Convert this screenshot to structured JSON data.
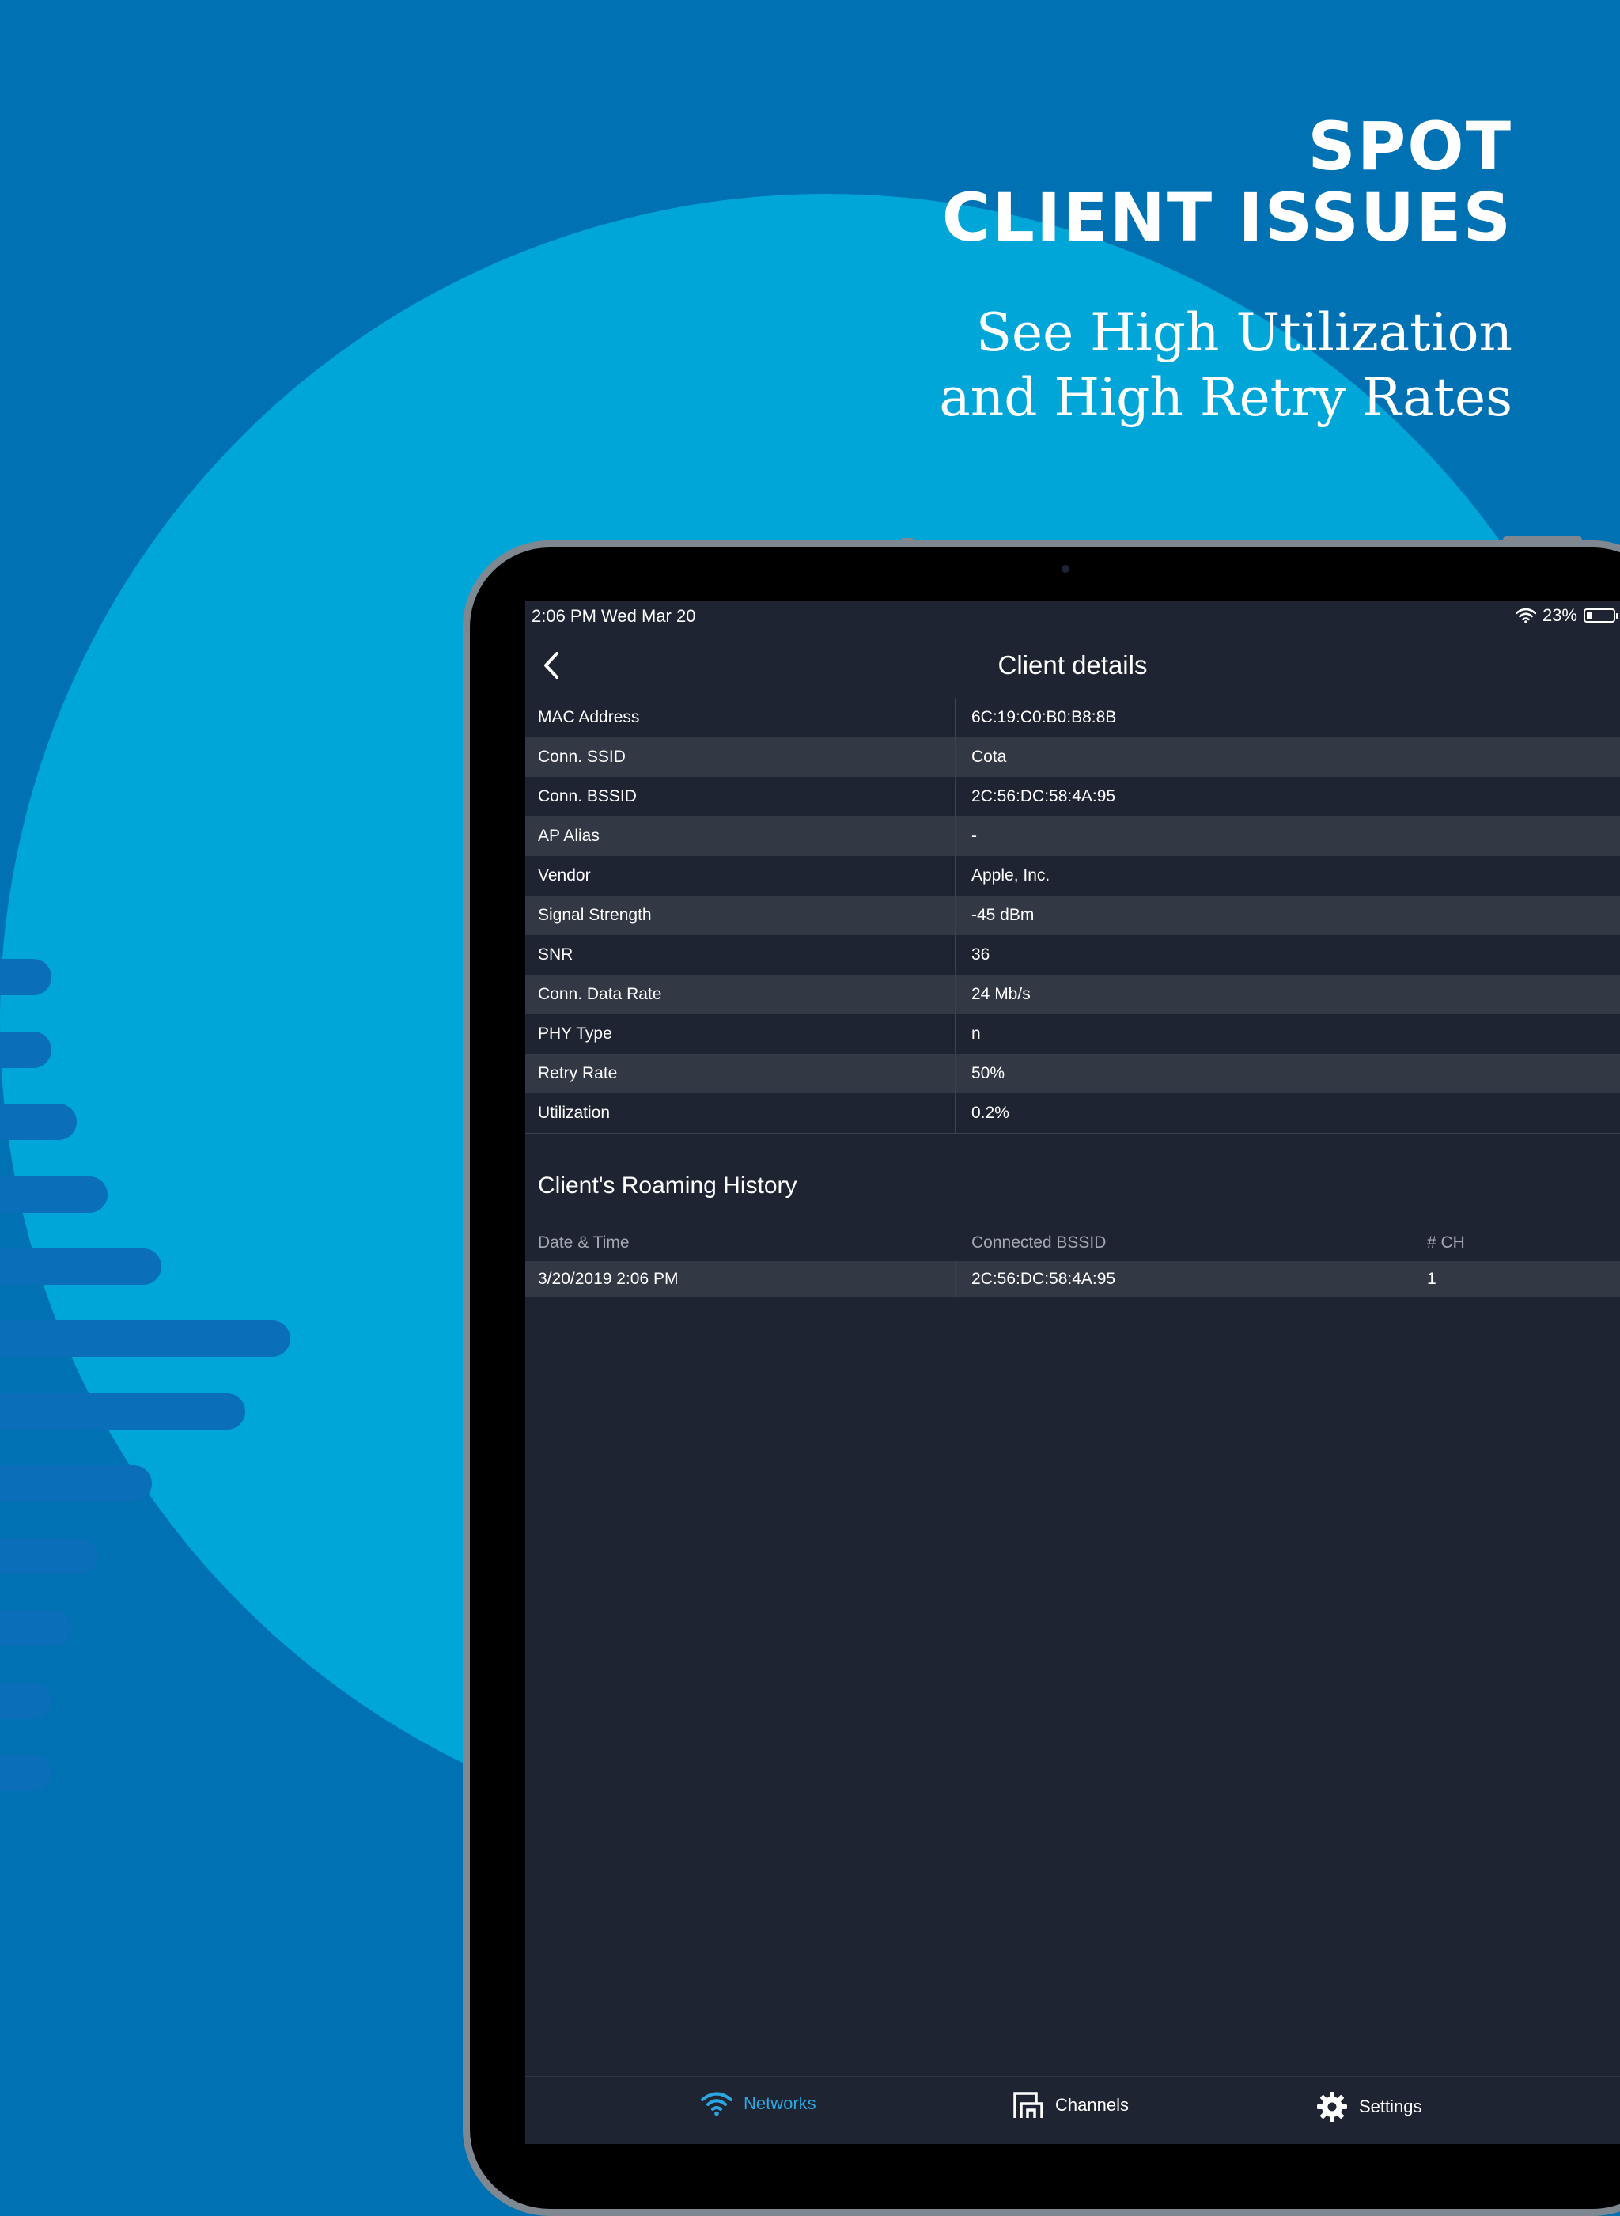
{
  "promo": {
    "headline_line1": "SPOT",
    "headline_line2": "CLIENT ISSUES",
    "subhead_line1": "See High Utilization",
    "subhead_line2": "and High Retry Rates"
  },
  "status_bar": {
    "time_date": "2:06 PM   Wed Mar 20",
    "battery": "23%",
    "battery_level": 0.23
  },
  "nav": {
    "title": "Client details",
    "back_icon": "chevron-left-icon"
  },
  "client_details": [
    {
      "label": "MAC Address",
      "value": "6C:19:C0:B0:B8:8B"
    },
    {
      "label": "Conn. SSID",
      "value": "Cota"
    },
    {
      "label": "Conn. BSSID",
      "value": "2C:56:DC:58:4A:95"
    },
    {
      "label": "AP Alias",
      "value": "-"
    },
    {
      "label": "Vendor",
      "value": "Apple, Inc."
    },
    {
      "label": "Signal Strength",
      "value": "-45 dBm"
    },
    {
      "label": "SNR",
      "value": "36"
    },
    {
      "label": "Conn. Data Rate",
      "value": "24 Mb/s"
    },
    {
      "label": "PHY Type",
      "value": "n"
    },
    {
      "label": "Retry Rate",
      "value": "50%"
    },
    {
      "label": "Utilization",
      "value": "0.2%"
    }
  ],
  "roaming": {
    "title": "Client's Roaming History",
    "columns": [
      "Date & Time",
      "Connected BSSID",
      "# CH"
    ],
    "rows": [
      [
        "3/20/2019 2:06 PM",
        "2C:56:DC:58:4A:95",
        "1"
      ]
    ]
  },
  "tabs": [
    {
      "label": "Networks",
      "icon": "wifi-icon",
      "active": true
    },
    {
      "label": "Channels",
      "icon": "channels-icon",
      "active": false
    },
    {
      "label": "Settings",
      "icon": "gear-icon",
      "active": false
    }
  ],
  "colors": {
    "background_blue": "#0071b2",
    "circle_blue": "#00a6d8",
    "accent": "#2aa7e0",
    "screen_bg": "#1f2432",
    "row_alt": "#333845"
  }
}
